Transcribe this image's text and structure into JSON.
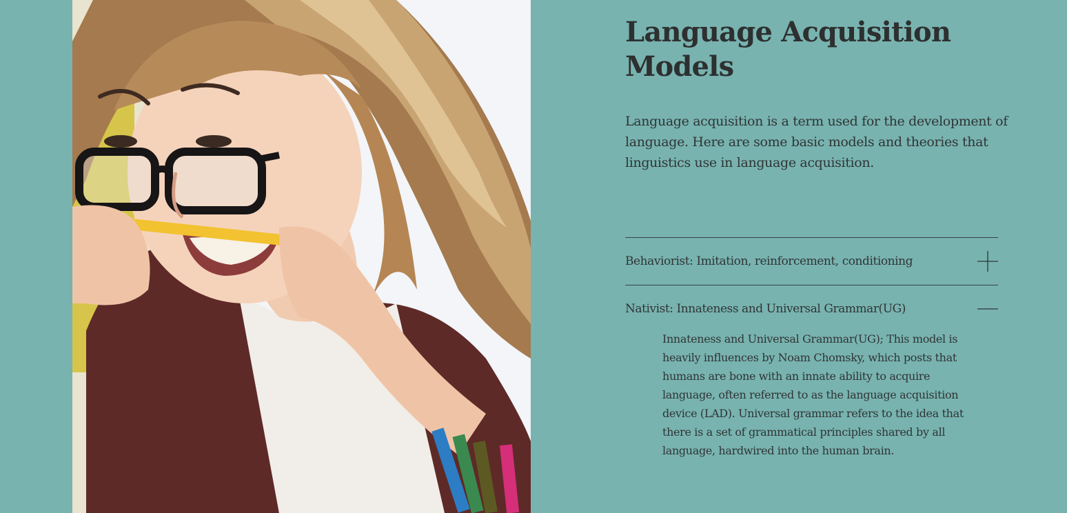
{
  "hero": {
    "title": "Language Acquisition Models",
    "intro": "Language acquisition is a term used for the development of language. Here are some basic models and theories that linguistics use in language acquisition."
  },
  "photo": {
    "subject": "woman-biting-pencil-photo"
  },
  "accordion": {
    "items": [
      {
        "label": "Behaviorist: Imitation, reinforcement, conditioning",
        "expanded": false,
        "icon": "plus-icon"
      },
      {
        "label": "Nativist: Innateness and Universal Grammar(UG)",
        "expanded": true,
        "icon": "minus-icon",
        "body": " Innateness and Universal Grammar(UG); This model is heavily influences by Noam Chomsky, which posts that humans are bone with an innate ability to acquire language, often referred to as the language acquisition device (LAD). Universal grammar refers to the idea that there is a set of grammatical principles shared by all language, hardwired into the human brain."
      }
    ]
  },
  "colors": {
    "background": "#78b3b0",
    "text": "#2f3534",
    "divider": "#3a4443"
  }
}
